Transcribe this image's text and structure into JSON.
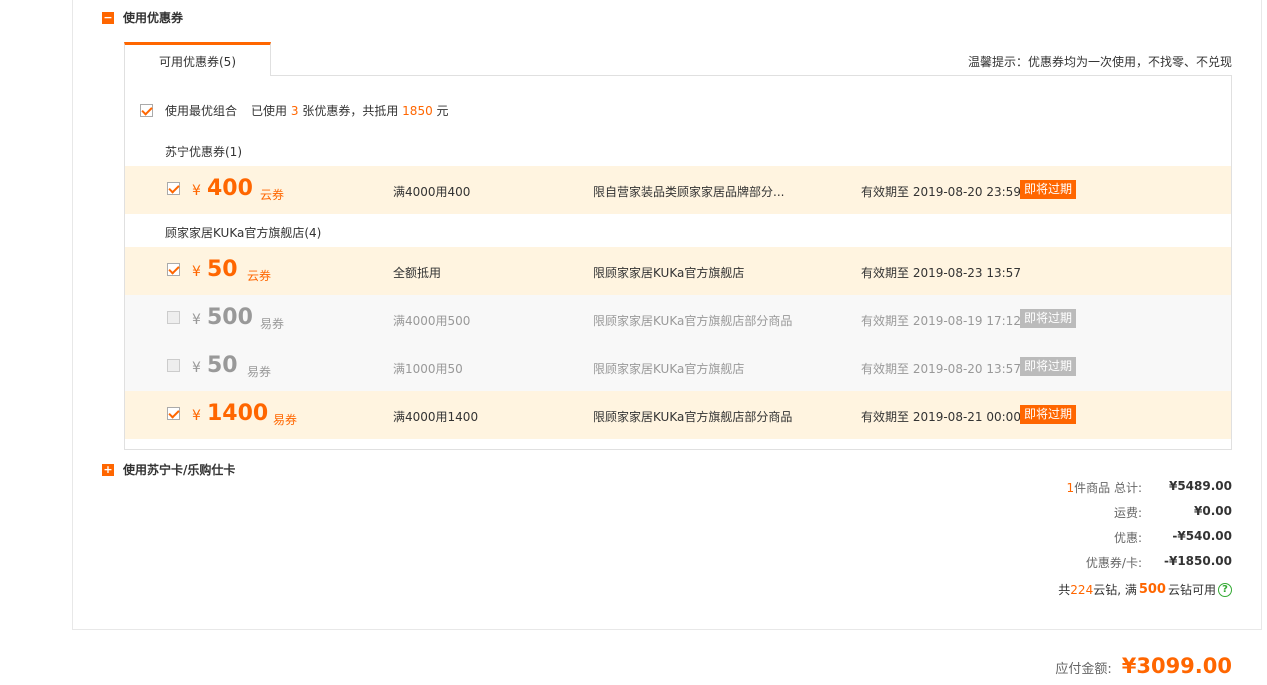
{
  "coupon_section": {
    "toggle": "−",
    "title": "使用优惠券"
  },
  "tab": {
    "label": "可用优惠券(5)"
  },
  "tip": "温馨提示：优惠券均为一次使用，不找零、不兑现",
  "best_combo": {
    "label": "使用最优组合",
    "used_prefix": "已使用",
    "used_count": "3",
    "used_mid": "张优惠券，共抵用",
    "used_amount": "1850",
    "used_suffix": "元"
  },
  "groups": [
    {
      "title": "苏宁优惠券(1)"
    },
    {
      "title": "顾家家居KUKa官方旗舰店(4)"
    }
  ],
  "coupons": [
    {
      "yen": "¥",
      "amount": "400",
      "type": "云券",
      "rule": "满4000用400",
      "scope": "限自营家装品类顾家家居品牌部分...",
      "valid": "有效期至 2019-08-20 23:59",
      "expire": "即将过期",
      "checked": true,
      "disabled": false
    },
    {
      "yen": "¥",
      "amount": "50",
      "type": "云券",
      "rule": "全额抵用",
      "scope": "限顾家家居KUKa官方旗舰店",
      "valid": "有效期至 2019-08-23 13:57",
      "expire": "",
      "checked": true,
      "disabled": false
    },
    {
      "yen": "¥",
      "amount": "500",
      "type": "易券",
      "rule": "满4000用500",
      "scope": "限顾家家居KUKa官方旗舰店部分商品",
      "valid": "有效期至 2019-08-19 17:12",
      "expire": "即将过期",
      "checked": false,
      "disabled": true
    },
    {
      "yen": "¥",
      "amount": "50",
      "type": "易券",
      "rule": "满1000用50",
      "scope": "限顾家家居KUKa官方旗舰店",
      "valid": "有效期至 2019-08-20 13:57",
      "expire": "即将过期",
      "checked": false,
      "disabled": true
    },
    {
      "yen": "¥",
      "amount": "1400",
      "type": "易券",
      "rule": "满4000用1400",
      "scope": "限顾家家居KUKa官方旗舰店部分商品",
      "valid": "有效期至 2019-08-21 00:00",
      "expire": "即将过期",
      "checked": true,
      "disabled": false
    }
  ],
  "card_section": {
    "toggle": "+",
    "title": "使用苏宁卡/乐购仕卡"
  },
  "summary": {
    "item_count": "1",
    "items_label": "件商品  总计:",
    "total": "¥5489.00",
    "shipping_label": "运费:",
    "shipping": "¥0.00",
    "discount_label": "优惠:",
    "discount": "-¥540.00",
    "coupon_label": "优惠券/卡:",
    "coupon": "-¥1850.00"
  },
  "coins": {
    "prefix": "共",
    "count": "224",
    "mid": "云钻, 满",
    "threshold": "500",
    "suffix": "云钻可用",
    "help": "?"
  },
  "pay": {
    "label": "应付金额:",
    "amount": "¥3099.00"
  },
  "colors": {
    "accent": "#ff6600",
    "selected_row": "#fff4e0",
    "disabled_row": "#f8f8f8"
  }
}
